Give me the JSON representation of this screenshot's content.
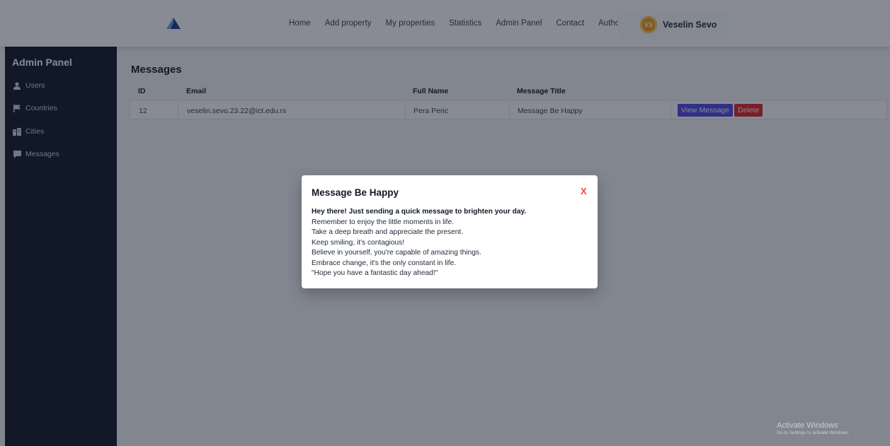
{
  "nav": {
    "links": [
      "Home",
      "Add property",
      "My properties",
      "Statistics",
      "Admin Panel",
      "Contact",
      "Author"
    ],
    "user": {
      "initials": "VS",
      "name": "Veselin Sevo"
    }
  },
  "sidebar": {
    "title": "Admin Panel",
    "items": [
      {
        "label": "Users",
        "icon": "user-icon"
      },
      {
        "label": "Countries",
        "icon": "flag-icon"
      },
      {
        "label": "Cities",
        "icon": "city-icon"
      },
      {
        "label": "Messages",
        "icon": "message-icon"
      }
    ]
  },
  "main": {
    "title": "Messages",
    "columns": [
      "ID",
      "Email",
      "Full Name",
      "Message Title"
    ],
    "rows": [
      {
        "id": "12",
        "email": "veselin.sevo.23.22@ict.edu.rs",
        "full_name": "Pera Peric",
        "message_title": "Message Be Happy"
      }
    ],
    "actions": {
      "view": "View Message",
      "delete": "Delete"
    }
  },
  "modal": {
    "title": "Message Be Happy",
    "close": "X",
    "lead": "Hey there! Just sending a quick message to brighten your day.",
    "lines": [
      "Remember to enjoy the little moments in life.",
      "Take a deep breath and appreciate the present.",
      "Keep smiling, it's contagious!",
      "Believe in yourself, you're capable of amazing things.",
      "Embrace change, it's the only constant in life.",
      "\"Hope you have a fantastic day ahead!\""
    ]
  },
  "watermark": {
    "title": "Activate Windows",
    "subtitle": "Go to Settings to activate Windows."
  },
  "colors": {
    "sidebar_bg": "#111827",
    "accent_view": "#4f46e5",
    "accent_delete": "#dc2626",
    "avatar": "#f59e0b",
    "close": "#ef4444"
  }
}
